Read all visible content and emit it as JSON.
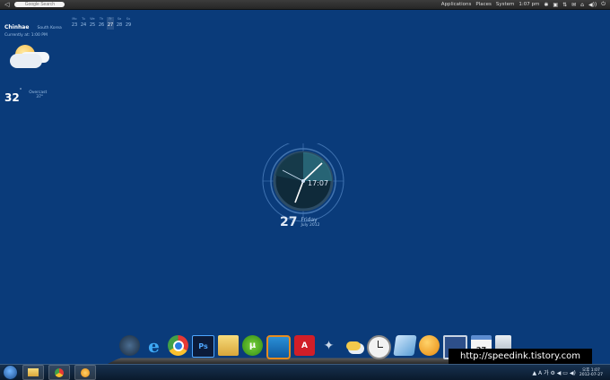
{
  "top_panel": {
    "back_icon": "◁",
    "search_placeholder": "Google Search",
    "menus": [
      "Applications",
      "Places",
      "System"
    ],
    "time": "1:07 pm",
    "tray_glyphs": [
      "✱",
      "▣",
      "⇅",
      "✉",
      "⌂",
      "◀))",
      "⏻"
    ]
  },
  "weather": {
    "city": "Chinhae",
    "country": "South Korea",
    "updated": "Currently at: 1:00 PM",
    "temperature": "32",
    "degree": "°",
    "condition": "Overcast",
    "low": "37°"
  },
  "mini_calendar": {
    "days": [
      "Mo",
      "Tu",
      "We",
      "Th",
      "Fr",
      "Sa",
      "Su"
    ],
    "dates": [
      "23",
      "24",
      "25",
      "26",
      "27",
      "28",
      "29"
    ],
    "today_index": 4
  },
  "clock": {
    "time": "17:07",
    "day_number": "27",
    "weekday": "Friday",
    "month_year": "July 2012"
  },
  "dock": {
    "items": [
      {
        "name": "windows-start",
        "label": ""
      },
      {
        "name": "internet-explorer",
        "label": "e"
      },
      {
        "name": "chrome",
        "label": ""
      },
      {
        "name": "photoshop",
        "label": "Ps"
      },
      {
        "name": "file-explorer",
        "label": ""
      },
      {
        "name": "utorrent",
        "label": "μ"
      },
      {
        "name": "vmware",
        "label": ""
      },
      {
        "name": "adobe-reader",
        "label": "A"
      },
      {
        "name": "satellite",
        "label": "✦"
      },
      {
        "name": "weather",
        "label": ""
      },
      {
        "name": "clock",
        "label": ""
      },
      {
        "name": "ice-app",
        "label": ""
      },
      {
        "name": "orange-app",
        "label": ""
      },
      {
        "name": "computer",
        "label": ""
      },
      {
        "name": "calendar",
        "label": "27"
      },
      {
        "name": "recycle-bin",
        "label": ""
      }
    ]
  },
  "watermark": "http://speedink.tistory.com",
  "taskbar": {
    "tray_icons": "▲ A 가 ⚙ ◀ ▭ ◀)",
    "clock_line1": "오후 1:07",
    "clock_line2": "2012-07-27"
  }
}
